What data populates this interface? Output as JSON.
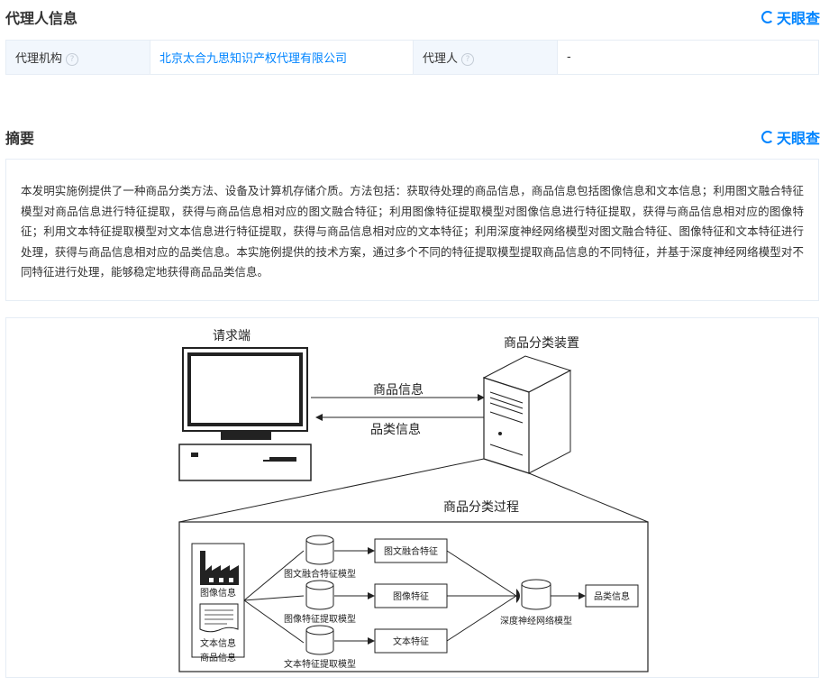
{
  "agent_section": {
    "title": "代理人信息",
    "brand": "天眼查",
    "agency_label": "代理机构",
    "help_glyph": "?",
    "agency_value": "北京太合九思知识产权代理有限公司",
    "agent_label": "代理人",
    "agent_value": "-"
  },
  "abstract_section": {
    "title": "摘要",
    "brand": "天眼查",
    "text": "本发明实施例提供了一种商品分类方法、设备及计算机存储介质。方法包括：获取待处理的商品信息，商品信息包括图像信息和文本信息；利用图文融合特征模型对商品信息进行特征提取，获得与商品信息相对应的图文融合特征；利用图像特征提取模型对图像信息进行特征提取，获得与商品信息相对应的图像特征；利用文本特征提取模型对文本信息进行特征提取，获得与商品信息相对应的文本特征；利用深度神经网络模型对图文融合特征、图像特征和文本特征进行处理，获得与商品信息相对应的品类信息。本实施例提供的技术方案，通过多个不同的特征提取模型提取商品信息的不同特征，并基于深度神经网络模型对不同特征进行处理，能够稳定地获得商品品类信息。"
  },
  "diagram": {
    "client_label": "请求端",
    "server_label": "商品分类装置",
    "arrow_to_server": "商品信息",
    "arrow_to_client": "品类信息",
    "process_title": "商品分类过程",
    "image_info": "图像信息",
    "text_info": "文本信息",
    "product_info": "商品信息",
    "model_fusion": "图文融合特征模型",
    "model_image": "图像特征提取模型",
    "model_text": "文本特征提取模型",
    "feat_fusion": "图文融合特征",
    "feat_image": "图像特征",
    "feat_text": "文本特征",
    "dnn": "深度神经网络模型",
    "category_info": "品类信息"
  }
}
